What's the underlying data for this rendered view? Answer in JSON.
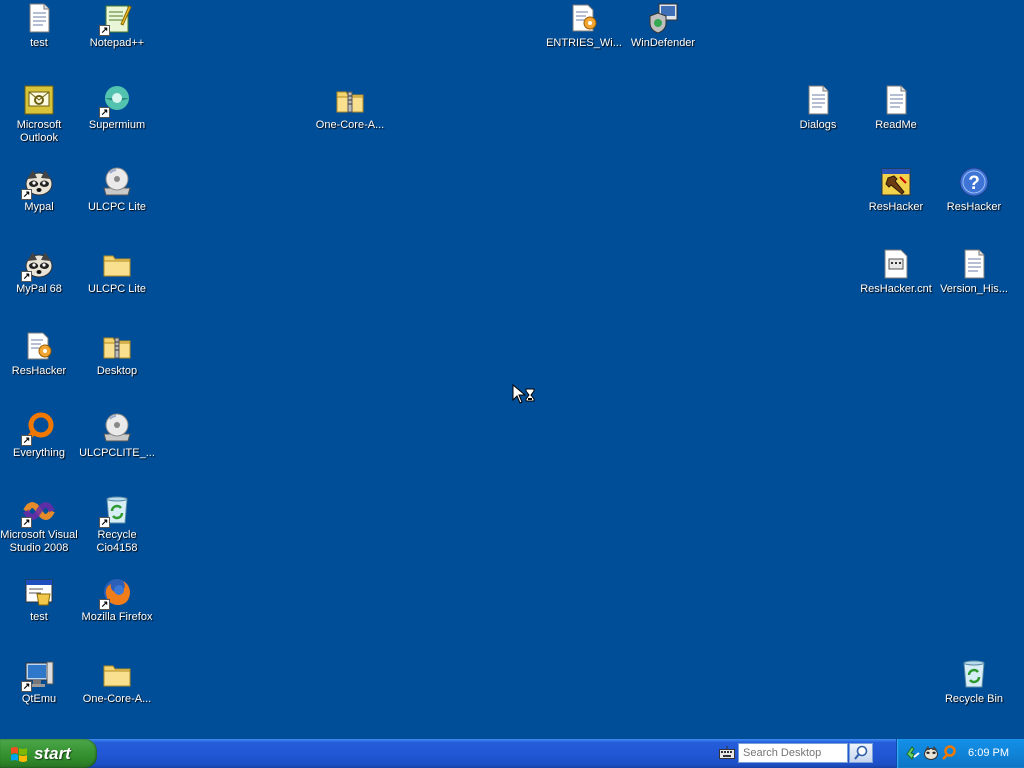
{
  "desktop": {
    "icons": [
      {
        "label": "test"
      },
      {
        "label": "Notepad++"
      },
      {
        "label": "ENTRIES_Wi..."
      },
      {
        "label": "WinDefender"
      },
      {
        "label": "Microsoft Outlook"
      },
      {
        "label": "Supermium"
      },
      {
        "label": "One-Core-A..."
      },
      {
        "label": "Dialogs"
      },
      {
        "label": "ReadMe"
      },
      {
        "label": "Mypal"
      },
      {
        "label": "ULCPC Lite"
      },
      {
        "label": "ResHacker"
      },
      {
        "label": "ResHacker"
      },
      {
        "label": "MyPal 68"
      },
      {
        "label": "ULCPC Lite"
      },
      {
        "label": "ResHacker.cnt"
      },
      {
        "label": "Version_His..."
      },
      {
        "label": "ResHacker"
      },
      {
        "label": "Desktop"
      },
      {
        "label": "Everything"
      },
      {
        "label": "ULCPCLITE_..."
      },
      {
        "label": "Microsoft Visual Studio 2008"
      },
      {
        "label": "Recycle Cio4158"
      },
      {
        "label": "test"
      },
      {
        "label": "Mozilla Firefox"
      },
      {
        "label": "QtEmu"
      },
      {
        "label": "One-Core-A..."
      },
      {
        "label": "Recycle Bin"
      }
    ]
  },
  "taskbar": {
    "start_label": "start",
    "search_placeholder": "Search Desktop",
    "clock": "6:09 PM"
  },
  "colors": {
    "desktop_background": "#004E98",
    "taskbar_blue": "#245DDB",
    "start_green": "#3C9838",
    "tray_blue": "#1084D8"
  }
}
